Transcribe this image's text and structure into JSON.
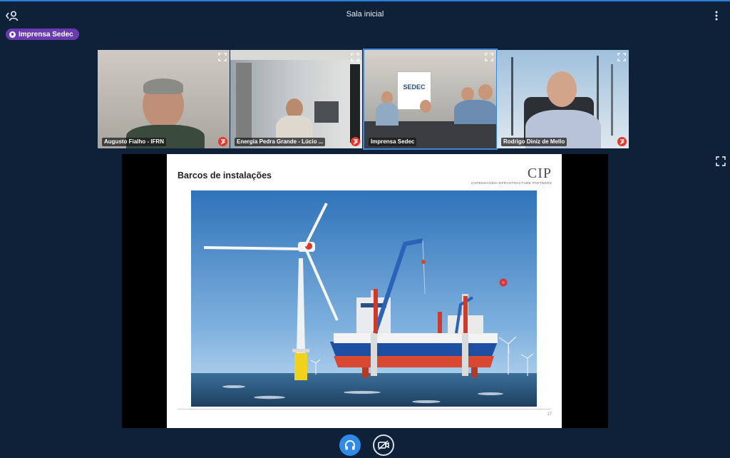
{
  "header": {
    "room_title": "Sala inicial",
    "presenter_label": "Imprensa Sedec"
  },
  "participants": [
    {
      "name": "Augusto Fialho - IFRN"
    },
    {
      "name": "Energia Pedra Grande - Lúcio ..."
    },
    {
      "name": "Imprensa Sedec",
      "active": true
    },
    {
      "name": "Rodrigo Diniz de Mello"
    }
  ],
  "slide": {
    "title": "Barcos de instalações",
    "logo_text": "CIP",
    "logo_subtext": "COPENHAGEN INFRASTRUCTURE PARTNERS",
    "page_number": "17",
    "image_description_icon": "wind-turbine-installation-vessel-photo"
  },
  "controls": {
    "audio_icon": "headphones-icon",
    "video_icon": "camera-off-icon"
  },
  "colors": {
    "background": "#0f2138",
    "accent": "#2f8be6",
    "presenter_badge": "#6a3ab0",
    "mute_badge": "#e03a2f",
    "active_tile_border": "#3f86d8"
  }
}
